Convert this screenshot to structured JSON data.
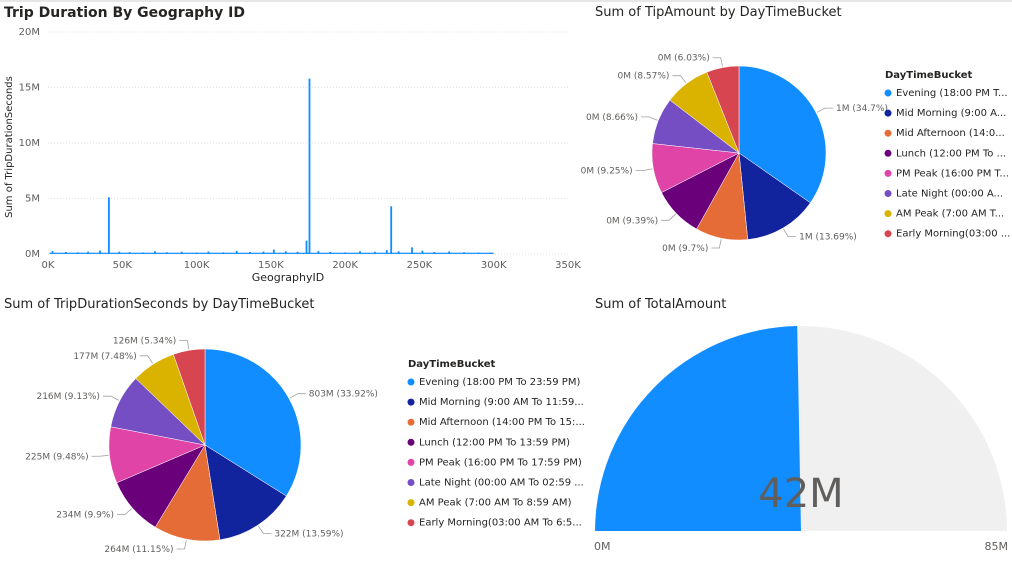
{
  "visuals": {
    "trip_duration": {
      "title": "Trip Duration By Geography ID"
    },
    "tip_amount": {
      "title": "Sum of TipAmount by DayTimeBucket"
    },
    "trip_seconds": {
      "title": "Sum of TripDurationSeconds by DayTimeBucket"
    },
    "total_amount": {
      "title": "Sum of TotalAmount"
    }
  },
  "colors": {
    "evening": "#118DFF",
    "mid_morning": "#12239E",
    "mid_afternoon": "#E66C37",
    "lunch": "#6B007B",
    "pm_peak": "#E044A7",
    "late_night": "#744EC2",
    "am_peak": "#D9B300",
    "early_morning": "#D64550",
    "gauge_track": "#F0F0F0"
  },
  "chart_data": [
    {
      "type": "bar",
      "title": "Trip Duration By Geography ID",
      "xlabel": "GeographyID",
      "ylabel": "Sum of TripDurationSeconds",
      "xlim": [
        0,
        350000
      ],
      "ylim": [
        0,
        20000000
      ],
      "x_ticks": [
        "0K",
        "50K",
        "100K",
        "150K",
        "200K",
        "250K",
        "300K",
        "350K"
      ],
      "y_ticks": [
        "0M",
        "5M",
        "10M",
        "15M",
        "20M"
      ],
      "grid": true,
      "x_tick_values": [
        0,
        50000,
        100000,
        150000,
        200000,
        250000,
        300000,
        350000
      ],
      "y_tick_values": [
        0,
        5000000,
        10000000,
        15000000,
        20000000
      ],
      "points": [
        [
          3000,
          260000
        ],
        [
          12000,
          180000
        ],
        [
          20000,
          150000
        ],
        [
          27000,
          220000
        ],
        [
          35000,
          300000
        ],
        [
          41000,
          5100000
        ],
        [
          48000,
          210000
        ],
        [
          55000,
          170000
        ],
        [
          64000,
          140000
        ],
        [
          72000,
          250000
        ],
        [
          80000,
          160000
        ],
        [
          90000,
          200000
        ],
        [
          100000,
          130000
        ],
        [
          108000,
          230000
        ],
        [
          118000,
          150000
        ],
        [
          127000,
          280000
        ],
        [
          136000,
          180000
        ],
        [
          145000,
          220000
        ],
        [
          152000,
          400000
        ],
        [
          160000,
          250000
        ],
        [
          168000,
          200000
        ],
        [
          174000,
          1200000
        ],
        [
          176000,
          15800000
        ],
        [
          182000,
          260000
        ],
        [
          190000,
          180000
        ],
        [
          200000,
          150000
        ],
        [
          210000,
          250000
        ],
        [
          220000,
          200000
        ],
        [
          228000,
          350000
        ],
        [
          231000,
          4300000
        ],
        [
          236000,
          240000
        ],
        [
          245000,
          600000
        ],
        [
          252000,
          300000
        ],
        [
          260000,
          180000
        ],
        [
          270000,
          230000
        ],
        [
          280000,
          160000
        ],
        [
          290000,
          120000
        ],
        [
          298000,
          140000
        ]
      ]
    },
    {
      "type": "pie",
      "title": "Sum of TipAmount by DayTimeBucket",
      "legend_title": "DayTimeBucket",
      "legend": "right",
      "slices": [
        {
          "name": "Evening (18:00 PM T...",
          "value": 34.7,
          "label": "1M (34.7%)"
        },
        {
          "name": "Mid Morning (9:00 A...",
          "value": 13.69,
          "label": "1M (13.69%)"
        },
        {
          "name": "Mid Afternoon (14:0...",
          "value": 9.7,
          "label": "0M (9.7%)"
        },
        {
          "name": "Lunch (12:00 PM To ...",
          "value": 9.39,
          "label": "0M (9.39%)"
        },
        {
          "name": "PM Peak (16:00 PM T...",
          "value": 9.25,
          "label": "0M (9.25%)"
        },
        {
          "name": "Late Night (00:00 A...",
          "value": 8.66,
          "label": "0M (8.66%)"
        },
        {
          "name": "AM Peak (7:00 AM T...",
          "value": 8.57,
          "label": "0M (8.57%)"
        },
        {
          "name": "Early Morning(03:00 ...",
          "value": 6.03,
          "label": "0M (6.03%)"
        }
      ]
    },
    {
      "type": "pie",
      "title": "Sum of TripDurationSeconds by DayTimeBucket",
      "legend_title": "DayTimeBucket",
      "legend": "right",
      "slices": [
        {
          "name": "Evening (18:00 PM To 23:59 PM)",
          "value": 33.92,
          "label": "803M (33.92%)"
        },
        {
          "name": "Mid Morning (9:00 AM To 11:59...",
          "value": 13.59,
          "label": "322M (13.59%)"
        },
        {
          "name": "Mid Afternoon (14:00 PM To 15:...",
          "value": 11.15,
          "label": "264M (11.15%)"
        },
        {
          "name": "Lunch (12:00 PM To 13:59 PM)",
          "value": 9.9,
          "label": "234M (9.9%)"
        },
        {
          "name": "PM Peak (16:00 PM To 17:59 PM)",
          "value": 9.48,
          "label": "225M (9.48%)"
        },
        {
          "name": "Late Night (00:00 AM To 02:59 ...",
          "value": 9.13,
          "label": "216M (9.13%)"
        },
        {
          "name": "AM Peak (7:00 AM To 8:59 AM)",
          "value": 7.48,
          "label": "177M (7.48%)"
        },
        {
          "name": "Early Morning(03:00 AM To 6:5...",
          "value": 5.34,
          "label": "126M (5.34%)"
        }
      ]
    },
    {
      "type": "gauge",
      "title": "Sum of TotalAmount",
      "value": 42000000,
      "value_label": "42M",
      "min": 0,
      "max": 85000000,
      "min_label": "0M",
      "max_label": "85M"
    }
  ]
}
